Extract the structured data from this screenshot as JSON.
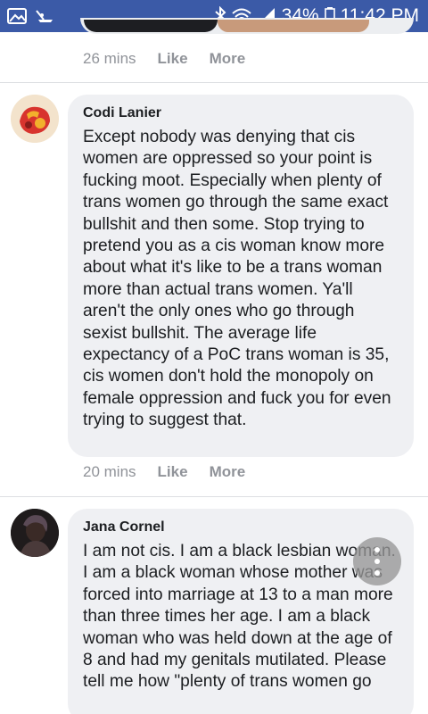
{
  "status_bar": {
    "battery": "34%",
    "time": "11:42 PM",
    "icons": [
      "gallery-icon",
      "app-notification-icon",
      "bluetooth-icon",
      "wifi-icon",
      "signal-icon",
      "battery-icon"
    ]
  },
  "comments": [
    {
      "time": "26 mins",
      "like_label": "Like",
      "more_label": "More"
    },
    {
      "author": "Codi Lanier",
      "text": "Except nobody was denying that cis women are oppressed so your point is fucking moot. Especially when plenty of trans women go through the same exact bullshit and then some. Stop trying to pretend you as a cis woman know more about what it's like to be a trans woman more than actual trans women. Ya'll aren't the only ones who go through sexist bullshit. The average life expectancy of a PoC trans woman is 35, cis women don't hold the monopoly on female oppression and fuck you for even trying to suggest that.",
      "time": "20 mins",
      "like_label": "Like",
      "more_label": "More"
    },
    {
      "author": "Jana Cornel",
      "text": "I am not cis. I am a black lesbian woman. I am a black woman whose mother was forced into marriage at 13 to a man more than three times her age. I am a black woman who was held down at the age of 8 and had my genitals mutilated. Please tell me how \"plenty of trans women go"
    }
  ],
  "colors": {
    "status_bar": "#3b5aa7",
    "bubble": "#eff0f3",
    "meta_text": "#909399",
    "body_text": "#1c1e21"
  },
  "floating_button": {
    "icon": "more-vertical-icon"
  }
}
